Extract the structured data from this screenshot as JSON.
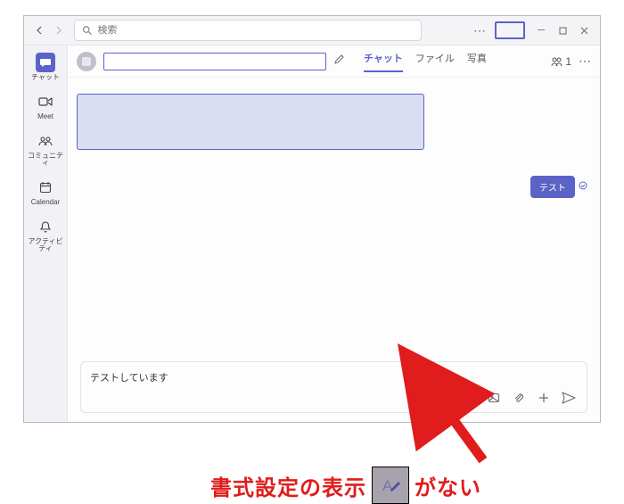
{
  "search": {
    "placeholder": "検索"
  },
  "rail": {
    "items": [
      {
        "label": "チャット"
      },
      {
        "label": "Meet"
      },
      {
        "label": "コミュニティ"
      },
      {
        "label": "Calendar"
      },
      {
        "label": "アクティビティ"
      }
    ]
  },
  "chat": {
    "tabs": [
      "チャット",
      "ファイル",
      "写真"
    ],
    "people_count": "1",
    "outgoing_message": "テスト",
    "compose_value": "テストしています"
  },
  "annotation": {
    "text_left": "書式設定の表示",
    "text_right": "がない"
  }
}
